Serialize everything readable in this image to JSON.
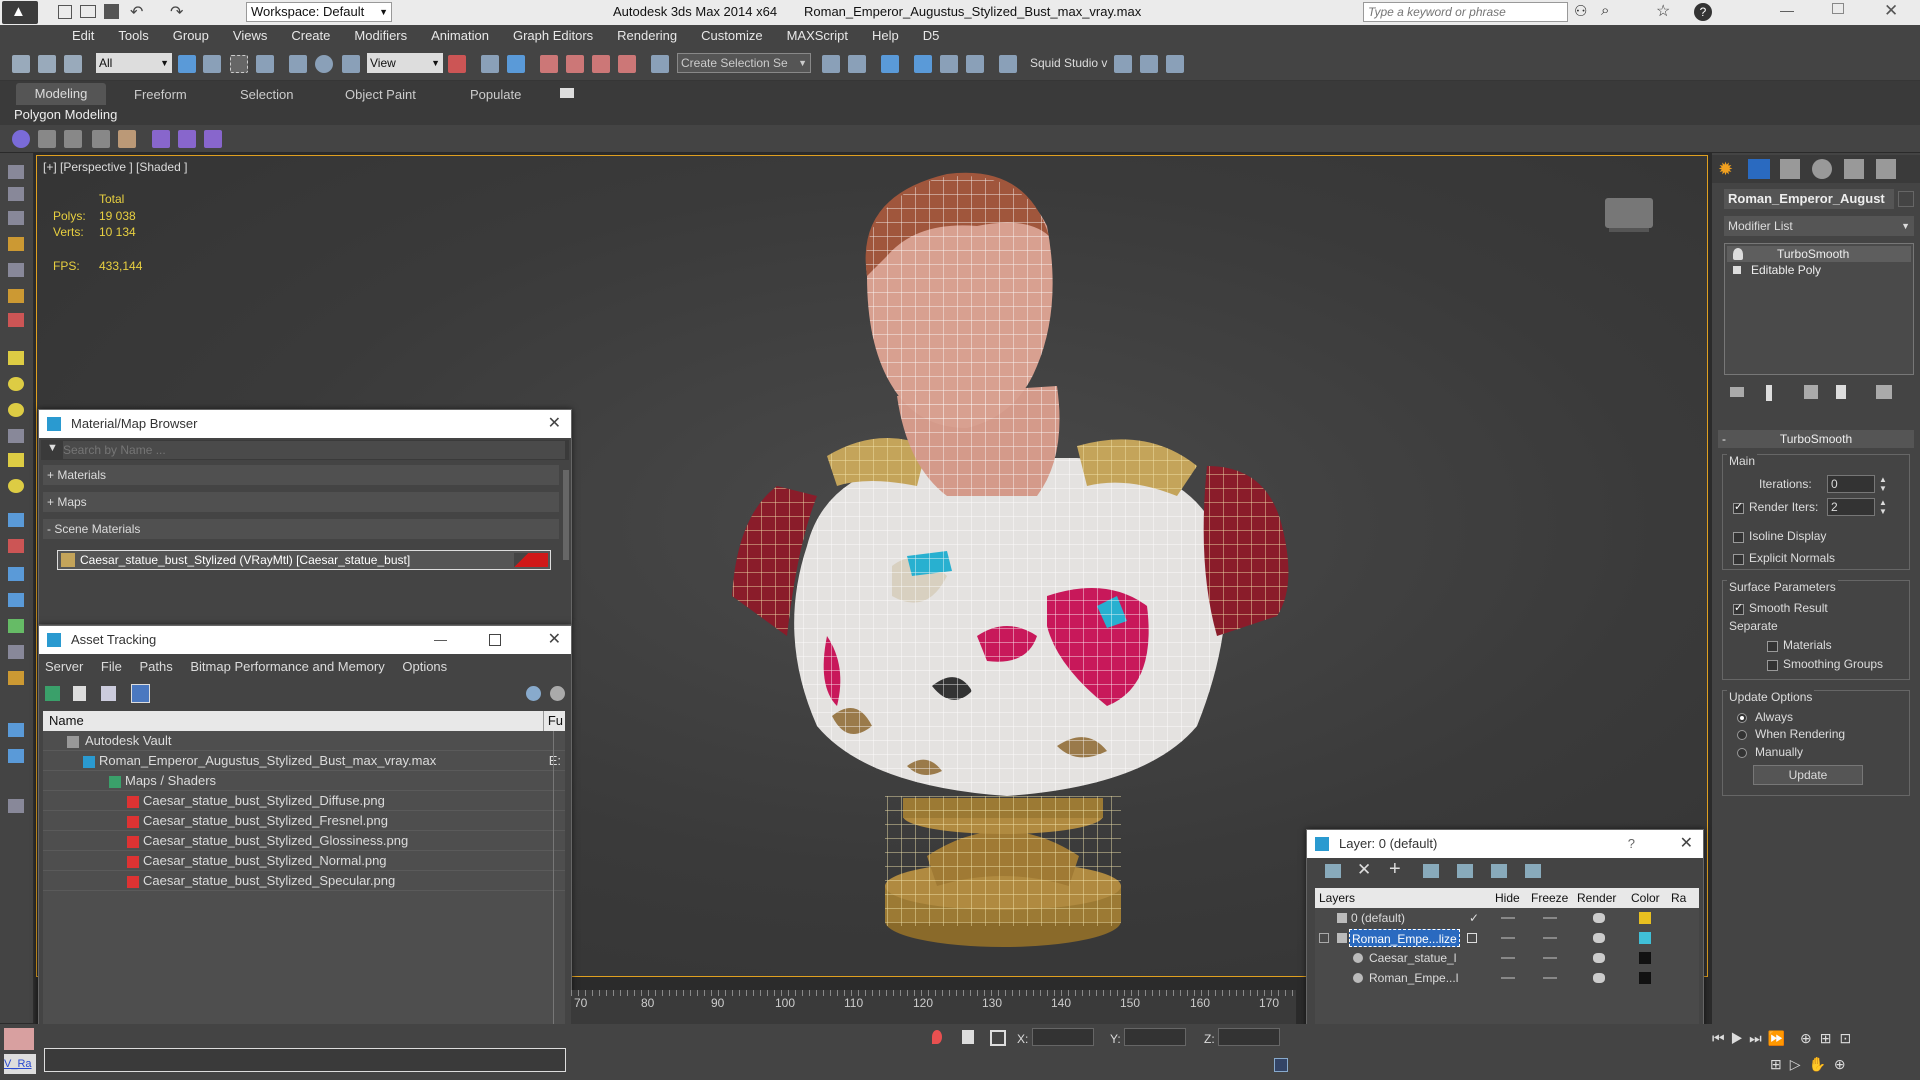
{
  "titlebar": {
    "app_title": "Autodesk 3ds Max  2014 x64",
    "file_title": "Roman_Emperor_Augustus_Stylized_Bust_max_vray.max",
    "workspace": "Workspace: Default",
    "search_placeholder": "Type a keyword or phrase"
  },
  "menu": [
    "Edit",
    "Tools",
    "Group",
    "Views",
    "Create",
    "Modifiers",
    "Animation",
    "Graph Editors",
    "Rendering",
    "Customize",
    "MAXScript",
    "Help",
    "D5"
  ],
  "toolbar": {
    "filter": "All",
    "ref_coord": "View",
    "selection_set": "Create Selection Se",
    "plugin": "Squid Studio v"
  },
  "ribbon": {
    "tabs": [
      "Modeling",
      "Freeform",
      "Selection",
      "Object Paint",
      "Populate"
    ],
    "active": "Modeling",
    "sub": "Polygon Modeling"
  },
  "viewport": {
    "label": "[+] [Perspective ] [Shaded ]",
    "stats": {
      "total_label": "Total",
      "polys_label": "Polys:",
      "polys": "19 038",
      "verts_label": "Verts:",
      "verts": "10 134",
      "fps_label": "FPS:",
      "fps": "433,144"
    }
  },
  "material_browser": {
    "title": "Material/Map Browser",
    "search": "Search by Name ...",
    "groups": [
      "+ Materials",
      "+ Maps",
      "- Scene Materials"
    ],
    "item": "Caesar_statue_bust_Stylized  (VRayMtl) [Caesar_statue_bust]"
  },
  "asset_tracking": {
    "title": "Asset Tracking",
    "menu": [
      "Server",
      "File",
      "Paths",
      "Bitmap Performance and Memory",
      "Options"
    ],
    "col_name": "Name",
    "col_f": "Fu",
    "rows": [
      {
        "text": "Autodesk Vault",
        "extra": ""
      },
      {
        "text": "Roman_Emperor_Augustus_Stylized_Bust_max_vray.max",
        "extra": "E:"
      },
      {
        "text": "Maps / Shaders",
        "extra": ""
      },
      {
        "text": "Caesar_statue_bust_Stylized_Diffuse.png",
        "extra": ""
      },
      {
        "text": "Caesar_statue_bust_Stylized_Fresnel.png",
        "extra": ""
      },
      {
        "text": "Caesar_statue_bust_Stylized_Glossiness.png",
        "extra": ""
      },
      {
        "text": "Caesar_statue_bust_Stylized_Normal.png",
        "extra": ""
      },
      {
        "text": "Caesar_statue_bust_Stylized_Specular.png",
        "extra": ""
      }
    ]
  },
  "layers": {
    "title": "Layer: 0 (default)",
    "headers": [
      "Layers",
      "Hide",
      "Freeze",
      "Render",
      "Color",
      "Ra"
    ],
    "rows": [
      {
        "name": "0 (default)",
        "color": "#e8c020"
      },
      {
        "name": "Roman_Empe...lize",
        "color": "#40c0d8"
      },
      {
        "name": "Caesar_statue_l",
        "color": "#111111"
      },
      {
        "name": "Roman_Empe...l",
        "color": "#111111"
      }
    ]
  },
  "cmdpanel": {
    "object_name": "Roman_Emperor_August",
    "modifier_list": "Modifier List",
    "stack": [
      "TurboSmooth",
      "Editable Poly"
    ],
    "rollout": "TurboSmooth",
    "main": "Main",
    "iterations_label": "Iterations:",
    "iterations": "0",
    "render_iters_label": "Render Iters:",
    "render_iters": "2",
    "isoline": "Isoline Display",
    "explicit": "Explicit Normals",
    "surface": "Surface Parameters",
    "smooth": "Smooth Result",
    "separate": "Separate",
    "materials": "Materials",
    "smoothing": "Smoothing Groups",
    "update_options": "Update Options",
    "always": "Always",
    "when_rendering": "When Rendering",
    "manually": "Manually",
    "update_btn": "Update"
  },
  "timeline": {
    "ticks": [
      "70",
      "80",
      "90",
      "100",
      "110",
      "120",
      "130",
      "140",
      "150",
      "160",
      "170"
    ]
  },
  "status": {
    "x": "X:",
    "y": "Y:",
    "z": "Z:",
    "script": "V_Ra"
  }
}
